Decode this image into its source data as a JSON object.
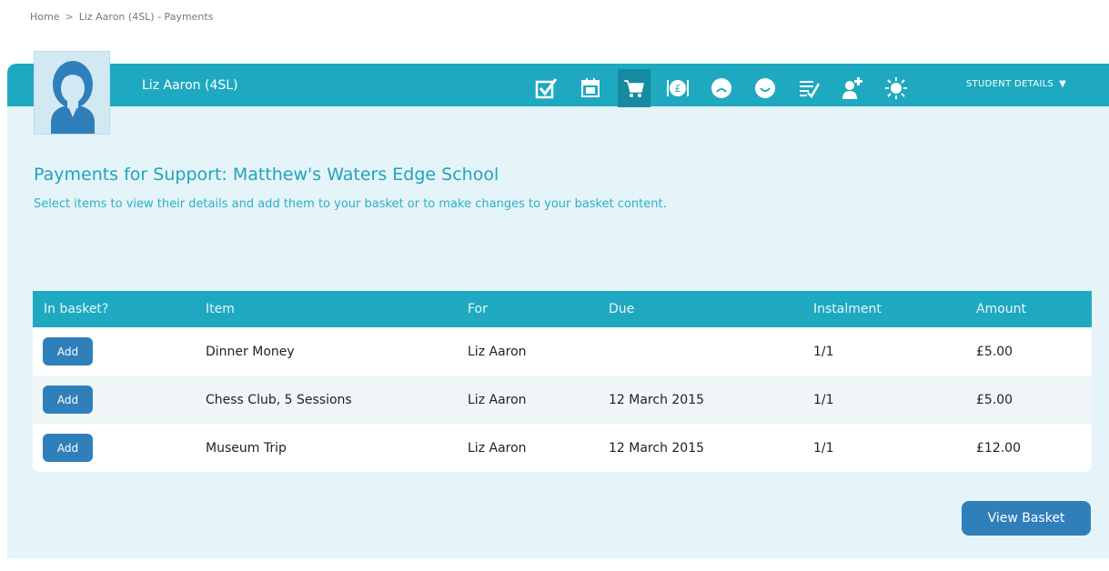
{
  "breadcrumb": {
    "home": "Home",
    "separator": ">",
    "current": "Liz Aaron (4SL) - Payments"
  },
  "header": {
    "student_name": "Liz Aaron (4SL)",
    "student_details_label": "STUDENT DETAILS",
    "menu_caret": "▼"
  },
  "icons": [
    "check-icon",
    "calendar-icon",
    "cart-icon",
    "dinner-money-icon",
    "sad-face-icon",
    "smiley-icon",
    "report-icon",
    "medical-person-icon",
    "sun-icon"
  ],
  "page": {
    "title": "Payments for Support: Matthew's Waters Edge School",
    "subtitle": "Select items to view their details and add them to your basket or to make changes to your basket content."
  },
  "table": {
    "headers": {
      "in_basket": "In basket?",
      "item": "Item",
      "for": "For",
      "due": "Due",
      "instalment": "Instalment",
      "amount": "Amount"
    },
    "rows": [
      {
        "button": "Add",
        "item": "Dinner Money",
        "for": "Liz Aaron",
        "due": "",
        "instalment": "1/1",
        "amount": "£5.00"
      },
      {
        "button": "Add",
        "item": "Chess Club, 5 Sessions",
        "for": "Liz Aaron",
        "due": "12 March 2015",
        "instalment": "1/1",
        "amount": "£5.00"
      },
      {
        "button": "Add",
        "item": "Museum Trip",
        "for": "Liz Aaron",
        "due": "12 March 2015",
        "instalment": "1/1",
        "amount": "£12.00"
      }
    ]
  },
  "view_basket_label": "View Basket",
  "colors": {
    "accent": "#1ea9c0",
    "button": "#2f7fbb",
    "panel": "#e5f4f8"
  }
}
